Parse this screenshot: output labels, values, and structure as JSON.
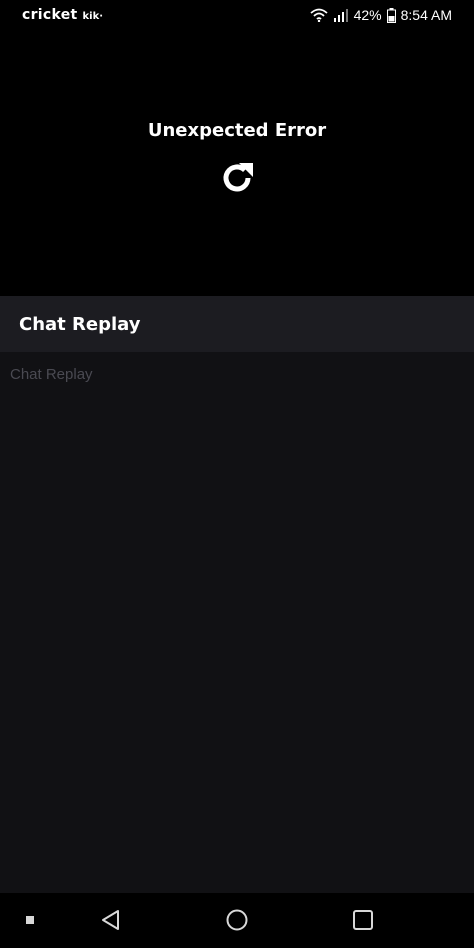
{
  "status_bar": {
    "carrier": "cricket",
    "carrier_app": "kik·",
    "battery": "42%",
    "time": "8:54 AM"
  },
  "player": {
    "error_title": "Unexpected Error",
    "refresh_icon": "refresh-icon"
  },
  "chat": {
    "header_title": "Chat Replay",
    "placeholder": "Chat Replay"
  },
  "nav_bar": {
    "icons": [
      "dot-icon",
      "back-icon",
      "home-icon",
      "recent-apps-icon"
    ]
  },
  "colors": {
    "background": "#000000",
    "chat_header": "#1c1c21",
    "chat_body": "#111114",
    "placeholder_text": "#4a4a52"
  }
}
